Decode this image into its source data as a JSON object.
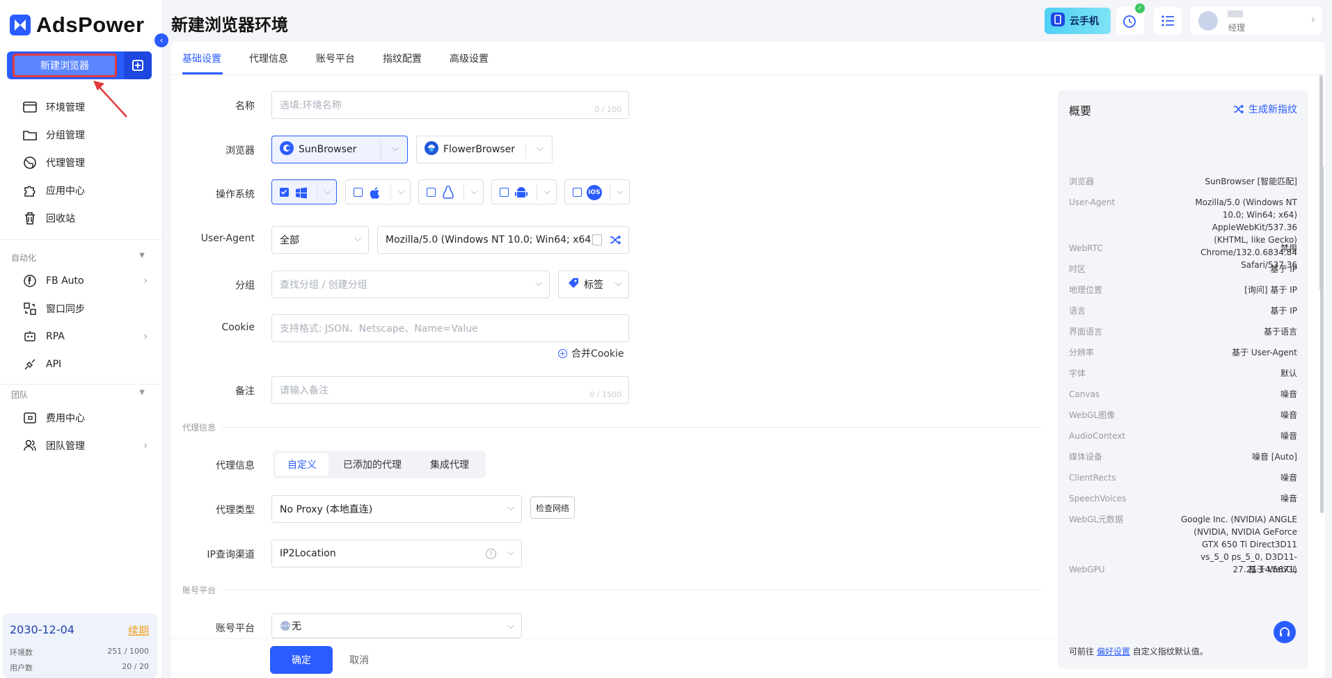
{
  "app": {
    "logo_text": "AdsPower",
    "new_browser_label": "新建浏览器"
  },
  "sidebar": {
    "items": [
      {
        "label": "环境管理",
        "icon": "browser-window-icon"
      },
      {
        "label": "分组管理",
        "icon": "folder-icon"
      },
      {
        "label": "代理管理",
        "icon": "globe-icon"
      },
      {
        "label": "应用中心",
        "icon": "puzzle-icon"
      },
      {
        "label": "回收站",
        "icon": "trash-icon"
      }
    ],
    "automation_title": "自动化",
    "automation_items": [
      {
        "label": "FB Auto",
        "icon": "fb-auto-icon"
      },
      {
        "label": "窗口同步",
        "icon": "window-sync-icon"
      },
      {
        "label": "RPA",
        "icon": "robot-icon"
      },
      {
        "label": "API",
        "icon": "api-icon"
      }
    ],
    "team_title": "团队",
    "team_items": [
      {
        "label": "费用中心",
        "icon": "wallet-icon"
      },
      {
        "label": "团队管理",
        "icon": "team-icon"
      }
    ],
    "footer": {
      "date": "2030-12-04",
      "renew": "续期",
      "env_label": "环境数",
      "env_value": "251 / 1000",
      "user_label": "用户数",
      "user_value": "20 / 20"
    }
  },
  "header": {
    "title": "新建浏览器环境",
    "cloud_phone": "云手机",
    "user_role": "经理"
  },
  "tabs": [
    "基础设置",
    "代理信息",
    "账号平台",
    "指纹配置",
    "高级设置"
  ],
  "form": {
    "name_label": "名称",
    "name_placeholder": "选填:环境名称",
    "name_count": "0 / 100",
    "browser_label": "浏览器",
    "browser_1": "SunBrowser",
    "browser_2": "FlowerBrowser",
    "os_label": "操作系统",
    "os_ios": "iOS",
    "ua_label": "User-Agent",
    "ua_mode": "全部",
    "ua_value": "Mozilla/5.0 (Windows NT 10.0; Win64; x64)",
    "group_label": "分组",
    "group_placeholder": "查找分组 / 创建分组",
    "tag_label": "标签",
    "cookie_label": "Cookie",
    "cookie_placeholder": "支持格式: JSON、Netscape、Name=Value",
    "merge_cookie": "合并Cookie",
    "note_label": "备注",
    "note_placeholder": "请输入备注",
    "note_count": "0 / 1500",
    "proxy_section": "代理信息",
    "proxy_label": "代理信息",
    "proxy_tabs": [
      "自定义",
      "已添加的代理",
      "集成代理"
    ],
    "proxy_type_label": "代理类型",
    "proxy_type_value": "No Proxy (本地直连)",
    "check_network": "检查网络",
    "ip_channel_label": "IP查询渠道",
    "ip_channel_value": "IP2Location",
    "account_section": "账号平台",
    "account_label": "账号平台",
    "account_value": "无"
  },
  "summary": {
    "title": "概要",
    "generate": "生成新指纹",
    "rows": [
      {
        "k": "浏览器",
        "v": "SunBrowser [智能匹配]"
      },
      {
        "k": "User-Agent",
        "v": "Mozilla/5.0 (Windows NT 10.0; Win64; x64) AppleWebKit/537.36 (KHTML, like Gecko) Chrome/132.0.6834.84 Safari/537.36"
      },
      {
        "k": "WebRTC",
        "v": "禁用"
      },
      {
        "k": "时区",
        "v": "基于 IP"
      },
      {
        "k": "地理位置",
        "v": "[询问] 基于 IP"
      },
      {
        "k": "语言",
        "v": "基于 IP"
      },
      {
        "k": "界面语言",
        "v": "基于语言"
      },
      {
        "k": "分辨率",
        "v": "基于 User-Agent"
      },
      {
        "k": "字体",
        "v": "默认"
      },
      {
        "k": "Canvas",
        "v": "噪音"
      },
      {
        "k": "WebGL图像",
        "v": "噪音"
      },
      {
        "k": "AudioContext",
        "v": "噪音"
      },
      {
        "k": "媒体设备",
        "v": "噪音 [Auto]"
      },
      {
        "k": "ClientRects",
        "v": "噪音"
      },
      {
        "k": "SpeechVoices",
        "v": "噪音"
      },
      {
        "k": "WebGL元数据",
        "v": "Google Inc. (NVIDIA) ANGLE (NVIDIA, NVIDIA GeForce GTX 650 Ti Direct3D11 vs_5_0 ps_5_0, D3D11-27.21.14.5671)"
      },
      {
        "k": "WebGPU",
        "v": "基于 WebGL"
      }
    ],
    "foot_pre": "可前往",
    "foot_link": "偏好设置",
    "foot_post": "自定义指纹默认值。"
  },
  "actions": {
    "ok": "确定",
    "cancel": "取消"
  },
  "colors": {
    "accent": "#2b5cff",
    "highlight_border": "#e23a3a"
  }
}
